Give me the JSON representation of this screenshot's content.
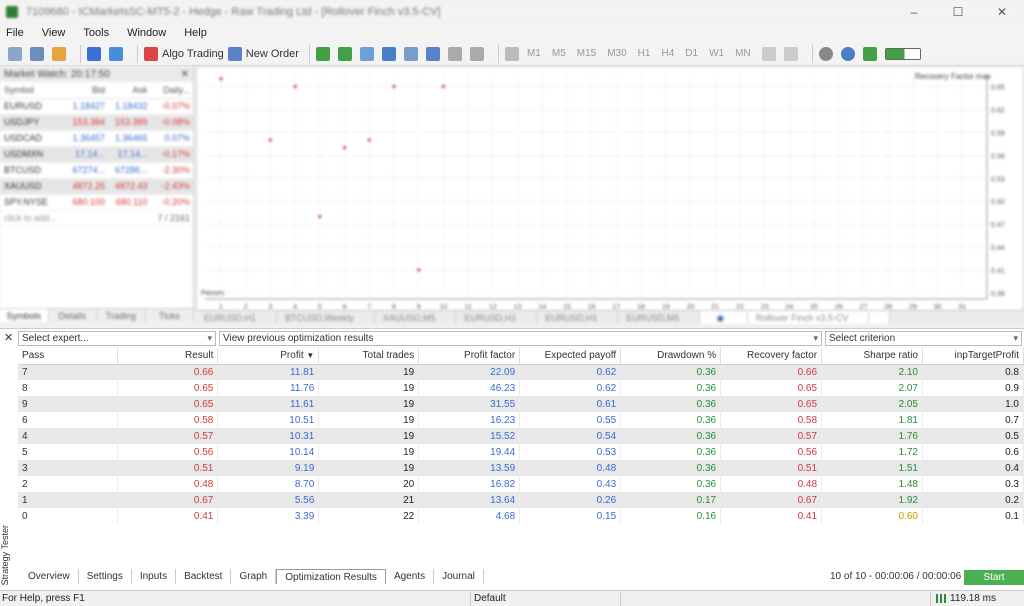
{
  "window": {
    "title": "7109680 - ICMarketsSC-MT5-2 - Hedge - Raw Trading Ltd - [Rollover Finch v3.5-CV]"
  },
  "menu": [
    "File",
    "View",
    "Tools",
    "Window",
    "Help"
  ],
  "toolbar": {
    "algo_trading": "Algo Trading",
    "new_order": "New Order",
    "timeframes": [
      "M1",
      "M5",
      "M15",
      "M30",
      "H1",
      "H4",
      "D1",
      "W1",
      "MN"
    ]
  },
  "market_watch": {
    "title": "Market Watch: 20:17:50",
    "headers": [
      "Symbol",
      "Bid",
      "Ask",
      "Daily..."
    ],
    "rows": [
      {
        "symbol": "EURUSD",
        "bid": "1.18427",
        "ask": "1.18432",
        "daily": "-0.07%"
      },
      {
        "symbol": "USDJPY",
        "bid": "153.384",
        "ask": "153.389",
        "daily": "-0.08%"
      },
      {
        "symbol": "USDCAD",
        "bid": "1.36457",
        "ask": "1.36465",
        "daily": "0.07%"
      },
      {
        "symbol": "USDMXN",
        "bid": "17.14...",
        "ask": "17.14...",
        "daily": "-0.17%"
      },
      {
        "symbol": "BTCUSD",
        "bid": "67274...",
        "ask": "67286...",
        "daily": "-2.30%"
      },
      {
        "symbol": "XAUUSD",
        "bid": "4872.25",
        "ask": "4872.43",
        "daily": "-2.43%"
      },
      {
        "symbol": "SPY.NYSE",
        "bid": "680.100",
        "ask": "680.110",
        "daily": "-0.20%"
      }
    ],
    "add_hint": "click to add...",
    "count": "7 / 2161",
    "tabs": [
      "Symbols",
      "Details",
      "Trading",
      "Ticks"
    ]
  },
  "chart": {
    "legend": "Recovery Factor max",
    "y_ticks": [
      "0.65",
      "0.62",
      "0.59",
      "0.56",
      "0.53",
      "0.50",
      "0.47",
      "0.44",
      "0.41",
      "0.38"
    ],
    "x_ticks": [
      "1",
      "2",
      "3",
      "4",
      "5",
      "6",
      "7",
      "8",
      "9",
      "10",
      "11",
      "12",
      "13",
      "14",
      "15",
      "16",
      "17",
      "18",
      "19",
      "20",
      "21",
      "22",
      "23",
      "24",
      "25",
      "26",
      "27",
      "28",
      "29",
      "30",
      "31"
    ],
    "x_title": "Passes",
    "points": [
      [
        1,
        0.66
      ],
      [
        3,
        0.58
      ],
      [
        4,
        0.65
      ],
      [
        5,
        0.48
      ],
      [
        6,
        0.57
      ],
      [
        7,
        0.58
      ],
      [
        8,
        0.65
      ],
      [
        9,
        0.41
      ],
      [
        10,
        0.65
      ]
    ]
  },
  "chart_tabs": [
    "EURUSD,H1",
    "BTCUSD,Weekly",
    "XAUUSD,M5",
    "EURUSD,H1",
    "EURUSD,H1",
    "EURUSD,M5",
    "Rollover Finch v3.5-CV"
  ],
  "tester": {
    "select_expert": "Select expert...",
    "view_results": "View previous optimization results",
    "select_criterion": "Select criterion",
    "columns": [
      "Pass",
      "Result",
      "Profit",
      "Total trades",
      "Profit factor",
      "Expected payoff",
      "Drawdown %",
      "Recovery factor",
      "Sharpe ratio",
      "inpTargetProfit"
    ],
    "sort_arrow": "▼",
    "rows": [
      [
        "7",
        "0.66",
        "11.81",
        "19",
        "22.09",
        "0.62",
        "0.36",
        "0.66",
        "2.10",
        "0.8"
      ],
      [
        "8",
        "0.65",
        "11.76",
        "19",
        "46.23",
        "0.62",
        "0.36",
        "0.65",
        "2.07",
        "0.9"
      ],
      [
        "9",
        "0.65",
        "11.61",
        "19",
        "31.55",
        "0.61",
        "0.36",
        "0.65",
        "2.05",
        "1.0"
      ],
      [
        "6",
        "0.58",
        "10.51",
        "19",
        "16.23",
        "0.55",
        "0.36",
        "0.58",
        "1.81",
        "0.7"
      ],
      [
        "4",
        "0.57",
        "10.31",
        "19",
        "15.52",
        "0.54",
        "0.36",
        "0.57",
        "1.76",
        "0.5"
      ],
      [
        "5",
        "0.56",
        "10.14",
        "19",
        "19.44",
        "0.53",
        "0.36",
        "0.56",
        "1.72",
        "0.6"
      ],
      [
        "3",
        "0.51",
        "9.19",
        "19",
        "13.59",
        "0.48",
        "0.36",
        "0.51",
        "1.51",
        "0.4"
      ],
      [
        "2",
        "0.48",
        "8.70",
        "20",
        "16.82",
        "0.43",
        "0.36",
        "0.48",
        "1.48",
        "0.3"
      ],
      [
        "1",
        "0.67",
        "5.56",
        "21",
        "13.64",
        "0.26",
        "0.17",
        "0.67",
        "1.92",
        "0.2"
      ],
      [
        "0",
        "0.41",
        "3.39",
        "22",
        "4.68",
        "0.15",
        "0.16",
        "0.41",
        "0.60",
        "0.1"
      ]
    ],
    "side_label": "Strategy Tester",
    "tabs": [
      "Overview",
      "Settings",
      "Inputs",
      "Backtest",
      "Graph",
      "Optimization Results",
      "Agents",
      "Journal"
    ],
    "progress": "10 of 10 - 00:00:06 / 00:00:06",
    "start": "Start"
  },
  "status": {
    "help": "For Help, press F1",
    "profile": "Default",
    "ping": "119.18 ms"
  },
  "colors": {
    "start_button": "#4caf50",
    "result": "#d43a3a",
    "blue": "#3a6ad0",
    "green": "#2e8b3a"
  }
}
